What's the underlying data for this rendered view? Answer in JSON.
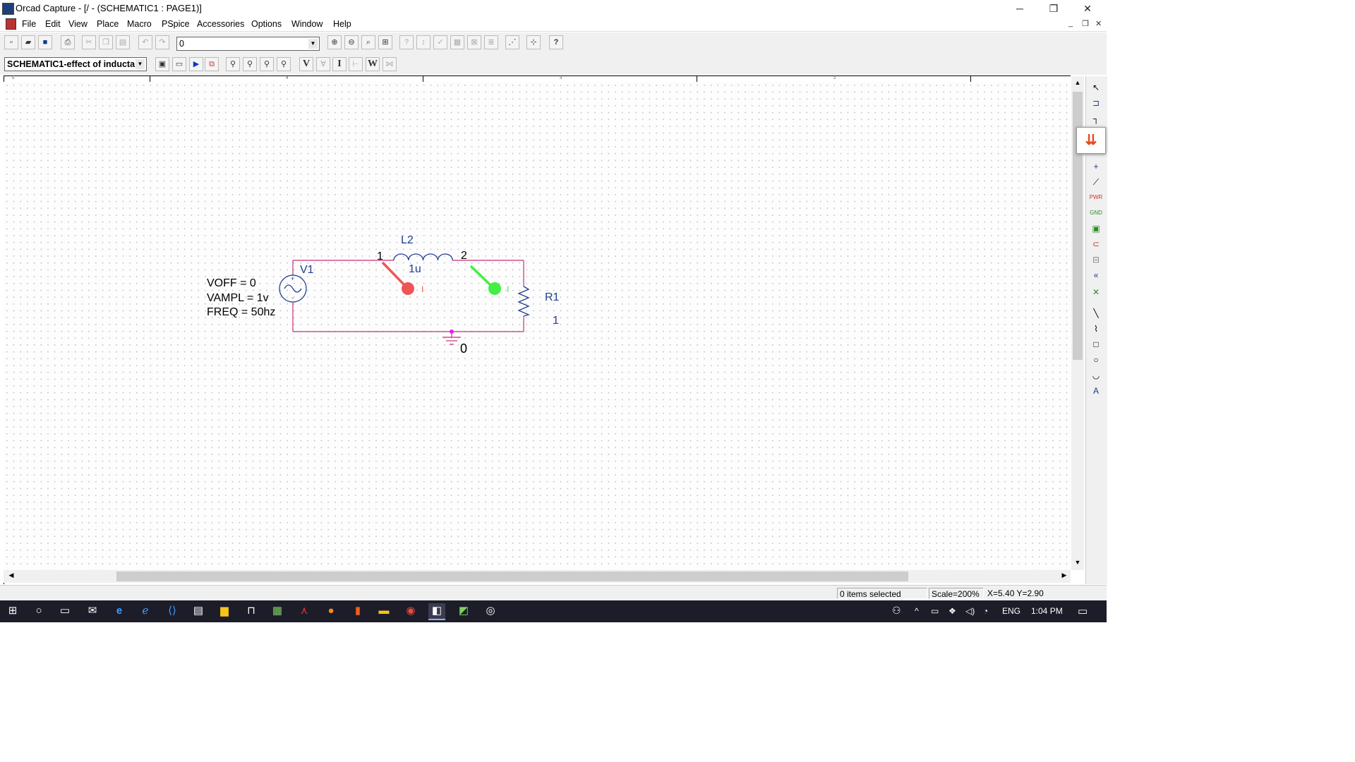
{
  "window": {
    "title": "Orcad Capture - [/ - (SCHEMATIC1 : PAGE1)]",
    "controls": [
      "─",
      "❐",
      "✕"
    ],
    "mdi_controls": [
      "_",
      "❐",
      "✕"
    ]
  },
  "menu": [
    "File",
    "Edit",
    "View",
    "Place",
    "Macro",
    "PSpice",
    "Accessories",
    "Options",
    "Window",
    "Help"
  ],
  "toolbar1": {
    "page_combo_value": "0"
  },
  "toolbar2": {
    "profile_combo_value": "SCHEMATIC1-effect of inducta",
    "markers": [
      "V",
      "I",
      "W"
    ]
  },
  "ruler": {
    "numbers": [
      "5",
      "4",
      "3",
      "2"
    ]
  },
  "schematic": {
    "source": {
      "ref": "V1",
      "params": [
        "VOFF = 0",
        "VAMPL = 1v",
        "FREQ = 50hz"
      ]
    },
    "inductor": {
      "ref": "L2",
      "value": "1u",
      "pin1": "1",
      "pin2": "2"
    },
    "resistor": {
      "ref": "R1",
      "value": "1"
    },
    "ground": {
      "label": "0"
    },
    "probes": [
      {
        "color": "#f05555",
        "label": "I"
      },
      {
        "color": "#44ee44",
        "label": "I"
      }
    ],
    "wire_color": "#c8307a",
    "part_color": "#1f3f8f"
  },
  "statusbar": {
    "selection": "0 items selected",
    "scale": "Scale=200%",
    "coords": "X=5.40  Y=2.90"
  },
  "taskbar": {
    "language": "ENG",
    "time": "1:04 PM"
  }
}
